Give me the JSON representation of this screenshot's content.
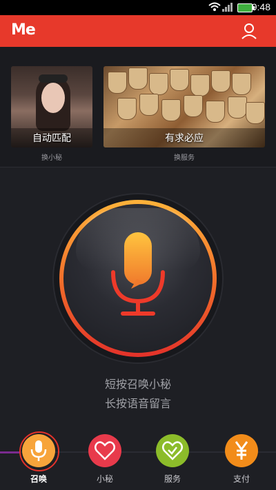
{
  "status": {
    "time": "9:48"
  },
  "header": {
    "logo": "Me"
  },
  "cards": [
    {
      "title": "自动匹配",
      "swap": "换小秘"
    },
    {
      "title": "有求必应",
      "swap": "换服务"
    }
  ],
  "mic_hint": {
    "line1": "短按召唤小秘",
    "line2": "长按语音留言"
  },
  "nav": [
    {
      "label": "召唤",
      "color": "#f7a43b"
    },
    {
      "label": "小秘",
      "color": "#e83a4b"
    },
    {
      "label": "服务",
      "color": "#8cbc2a"
    },
    {
      "label": "支付",
      "color": "#f28c1a"
    }
  ],
  "colors": {
    "appbar": "#e7392b",
    "ring": "#e3322a",
    "accent": "#f7a43b"
  }
}
